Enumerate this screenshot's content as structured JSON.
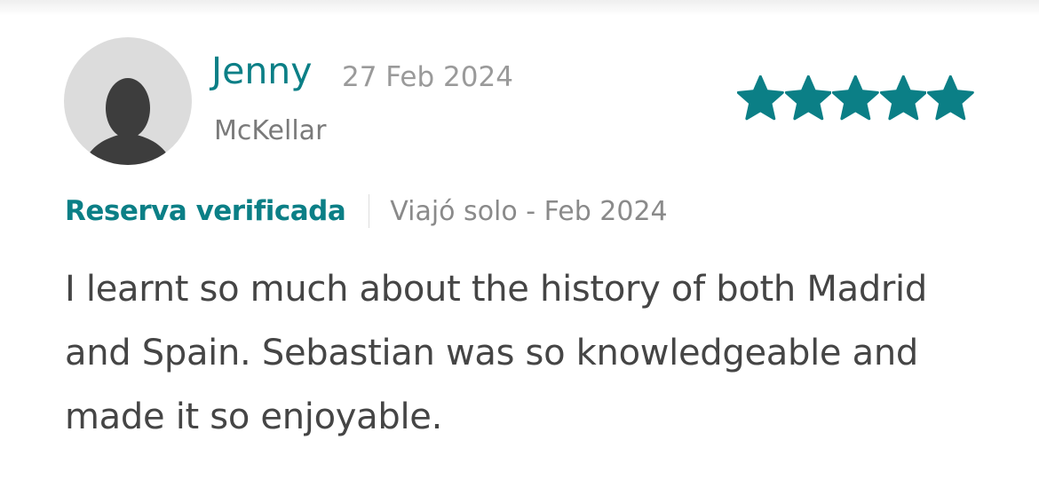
{
  "review": {
    "reviewer_name": "Jenny",
    "date": "27 Feb 2024",
    "location": "McKellar",
    "rating": 5,
    "rating_max": 5,
    "verified_label": "Reserva verificada",
    "trip_info": "Viajó solo - Feb 2024",
    "body": "I learnt so much about the history of both Madrid and Spain. Sebastian was so knowledgeable and made it so enjoyable."
  },
  "icons": {
    "avatar": "default-user-avatar-icon",
    "star": "star-icon"
  },
  "colors": {
    "accent": "#0b7f86",
    "date_text": "#9a9a9a",
    "body_text": "#454545",
    "avatar_bg": "#dcdcdc",
    "avatar_silhouette": "#3d3d3d"
  }
}
